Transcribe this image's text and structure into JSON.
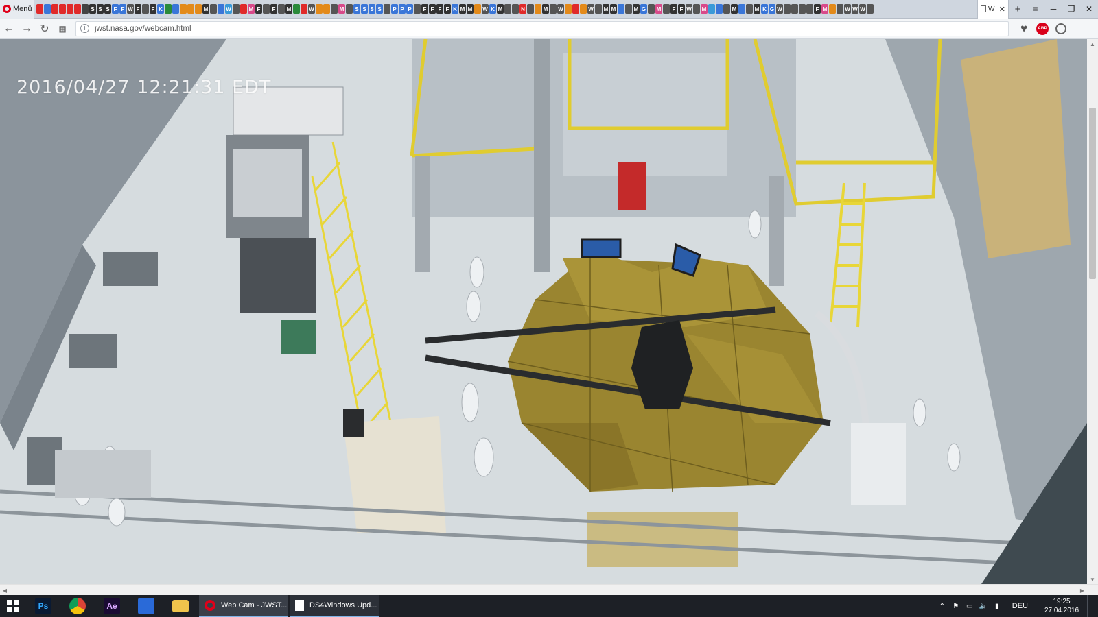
{
  "browser": {
    "menu_label": "Menü",
    "url": "jwst.nasa.gov/webcam.html",
    "active_tab_label": "W",
    "mini_tabs": [
      {
        "glyph": "",
        "color": "#e02a2a"
      },
      {
        "glyph": "",
        "color": "#3a76d8"
      },
      {
        "glyph": "",
        "color": "#e02a2a"
      },
      {
        "glyph": "",
        "color": "#e02a2a"
      },
      {
        "glyph": "",
        "color": "#e02a2a"
      },
      {
        "glyph": "",
        "color": "#e02a2a"
      },
      {
        "glyph": "",
        "color": "#444444"
      },
      {
        "glyph": "S",
        "color": "#333333"
      },
      {
        "glyph": "S",
        "color": "#333333"
      },
      {
        "glyph": "S",
        "color": "#333333"
      },
      {
        "glyph": "F",
        "color": "#3a76d8"
      },
      {
        "glyph": "F",
        "color": "#3a76d8"
      },
      {
        "glyph": "W",
        "color": "#555555"
      },
      {
        "glyph": "F",
        "color": "#333333"
      },
      {
        "glyph": "",
        "color": "#555555"
      },
      {
        "glyph": "F",
        "color": "#333333"
      },
      {
        "glyph": "K",
        "color": "#3a76d8"
      },
      {
        "glyph": "",
        "color": "#2a8a3a"
      },
      {
        "glyph": "",
        "color": "#3a76d8"
      },
      {
        "glyph": "",
        "color": "#e38a1a"
      },
      {
        "glyph": "",
        "color": "#e38a1a"
      },
      {
        "glyph": "",
        "color": "#e38a1a"
      },
      {
        "glyph": "M",
        "color": "#333333"
      },
      {
        "glyph": "",
        "color": "#555555"
      },
      {
        "glyph": "",
        "color": "#3a76d8"
      },
      {
        "glyph": "W",
        "color": "#3a9ad8"
      },
      {
        "glyph": "",
        "color": "#555555"
      },
      {
        "glyph": "",
        "color": "#e02a2a"
      },
      {
        "glyph": "M",
        "color": "#d84a8a"
      },
      {
        "glyph": "F",
        "color": "#333333"
      },
      {
        "glyph": "",
        "color": "#555555"
      },
      {
        "glyph": "F",
        "color": "#333333"
      },
      {
        "glyph": "",
        "color": "#555555"
      },
      {
        "glyph": "M",
        "color": "#333333"
      },
      {
        "glyph": "",
        "color": "#2a8a3a"
      },
      {
        "glyph": "",
        "color": "#e02a2a"
      },
      {
        "glyph": "W",
        "color": "#555555"
      },
      {
        "glyph": "",
        "color": "#e38a1a"
      },
      {
        "glyph": "",
        "color": "#e38a1a"
      },
      {
        "glyph": "",
        "color": "#555555"
      },
      {
        "glyph": "M",
        "color": "#d84a8a"
      },
      {
        "glyph": "",
        "color": "#555555"
      },
      {
        "glyph": "S",
        "color": "#3a76d8"
      },
      {
        "glyph": "S",
        "color": "#3a76d8"
      },
      {
        "glyph": "S",
        "color": "#3a76d8"
      },
      {
        "glyph": "S",
        "color": "#3a76d8"
      },
      {
        "glyph": "",
        "color": "#555555"
      },
      {
        "glyph": "P",
        "color": "#3a76d8"
      },
      {
        "glyph": "P",
        "color": "#3a76d8"
      },
      {
        "glyph": "P",
        "color": "#3a76d8"
      },
      {
        "glyph": "",
        "color": "#555555"
      },
      {
        "glyph": "F",
        "color": "#333333"
      },
      {
        "glyph": "F",
        "color": "#333333"
      },
      {
        "glyph": "F",
        "color": "#333333"
      },
      {
        "glyph": "F",
        "color": "#333333"
      },
      {
        "glyph": "K",
        "color": "#3a76d8"
      },
      {
        "glyph": "M",
        "color": "#333333"
      },
      {
        "glyph": "M",
        "color": "#333333"
      },
      {
        "glyph": "",
        "color": "#e38a1a"
      },
      {
        "glyph": "W",
        "color": "#555555"
      },
      {
        "glyph": "K",
        "color": "#3a76d8"
      },
      {
        "glyph": "M",
        "color": "#333333"
      },
      {
        "glyph": "",
        "color": "#555555"
      },
      {
        "glyph": "",
        "color": "#555555"
      },
      {
        "glyph": "N",
        "color": "#e02a2a"
      },
      {
        "glyph": "",
        "color": "#555555"
      },
      {
        "glyph": "",
        "color": "#e38a1a"
      },
      {
        "glyph": "M",
        "color": "#333333"
      },
      {
        "glyph": "",
        "color": "#555555"
      },
      {
        "glyph": "W",
        "color": "#555555"
      },
      {
        "glyph": "",
        "color": "#e38a1a"
      },
      {
        "glyph": "",
        "color": "#e02a2a"
      },
      {
        "glyph": "",
        "color": "#e38a1a"
      },
      {
        "glyph": "W",
        "color": "#555555"
      },
      {
        "glyph": "",
        "color": "#555555"
      },
      {
        "glyph": "M",
        "color": "#333333"
      },
      {
        "glyph": "M",
        "color": "#333333"
      },
      {
        "glyph": "",
        "color": "#3a76d8"
      },
      {
        "glyph": "",
        "color": "#555555"
      },
      {
        "glyph": "M",
        "color": "#333333"
      },
      {
        "glyph": "G",
        "color": "#3a76d8"
      },
      {
        "glyph": "",
        "color": "#555555"
      },
      {
        "glyph": "M",
        "color": "#d84a8a"
      },
      {
        "glyph": "",
        "color": "#555555"
      },
      {
        "glyph": "F",
        "color": "#333333"
      },
      {
        "glyph": "F",
        "color": "#333333"
      },
      {
        "glyph": "W",
        "color": "#555555"
      },
      {
        "glyph": "",
        "color": "#555555"
      },
      {
        "glyph": "M",
        "color": "#d84a8a"
      },
      {
        "glyph": "",
        "color": "#3a9ad8"
      },
      {
        "glyph": "",
        "color": "#3a76d8"
      },
      {
        "glyph": "",
        "color": "#555555"
      },
      {
        "glyph": "M",
        "color": "#333333"
      },
      {
        "glyph": "",
        "color": "#3a76d8"
      },
      {
        "glyph": "",
        "color": "#555555"
      },
      {
        "glyph": "M",
        "color": "#333333"
      },
      {
        "glyph": "K",
        "color": "#3a76d8"
      },
      {
        "glyph": "G",
        "color": "#3a76d8"
      },
      {
        "glyph": "W",
        "color": "#555555"
      },
      {
        "glyph": "",
        "color": "#555555"
      },
      {
        "glyph": "",
        "color": "#555555"
      },
      {
        "glyph": "",
        "color": "#555555"
      },
      {
        "glyph": "",
        "color": "#555555"
      },
      {
        "glyph": "F",
        "color": "#333333"
      },
      {
        "glyph": "M",
        "color": "#d84a8a"
      },
      {
        "glyph": "",
        "color": "#e38a1a"
      },
      {
        "glyph": "",
        "color": "#555555"
      },
      {
        "glyph": "W",
        "color": "#555555"
      },
      {
        "glyph": "W",
        "color": "#555555"
      },
      {
        "glyph": "W",
        "color": "#555555"
      },
      {
        "glyph": "",
        "color": "#555555"
      }
    ]
  },
  "webcam": {
    "timestamp": "2016/04/27 12:21:31  EDT"
  },
  "taskbar": {
    "pinned": [
      {
        "name": "photoshop-icon",
        "glyph": "Ps",
        "bg": "#0a1a33",
        "fg": "#31a8ff"
      },
      {
        "name": "chrome-icon",
        "glyph": "",
        "bg": "transparent",
        "fg": "#fff"
      },
      {
        "name": "after-effects-icon",
        "glyph": "Ae",
        "bg": "#1a0b33",
        "fg": "#d8a6ff"
      },
      {
        "name": "app-blue-icon",
        "glyph": "",
        "bg": "#2a6ad8",
        "fg": "#fff"
      },
      {
        "name": "file-explorer-icon",
        "glyph": "",
        "bg": "transparent",
        "fg": "#fff"
      }
    ],
    "windows": [
      {
        "name": "task-webcam-jwst",
        "label": "Web Cam - JWST..."
      },
      {
        "name": "task-ds4windows",
        "label": "DS4Windows Upd..."
      }
    ],
    "language": "DEU",
    "time": "19:25",
    "date": "27.04.2016"
  },
  "colors": {
    "tabbar_bg": "#cfd6df",
    "taskbar_bg": "#1d2026",
    "mirror_gold": "#9a8530",
    "scaffold_yellow": "#e6d23a",
    "floor": "#d8dde0"
  }
}
